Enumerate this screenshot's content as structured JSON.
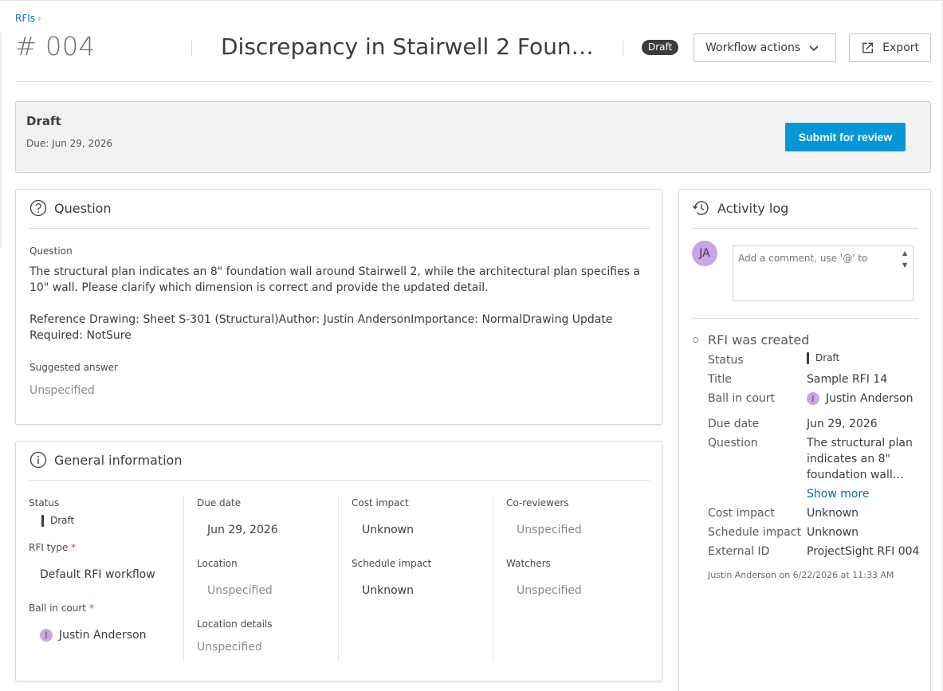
{
  "breadcrumb": {
    "label": "RFIs",
    "separator": "›"
  },
  "header": {
    "number": "# 004",
    "title": "Discrepancy in Stairwell 2 Foun…",
    "status_pill": "Draft",
    "workflow_label": "Workflow actions",
    "export_label": "Export"
  },
  "banner": {
    "title": "Draft",
    "due": "Due: Jun 29, 2026",
    "submit_label": "Submit for review"
  },
  "question_card": {
    "heading": "Question",
    "question_label": "Question",
    "question_line1": "The structural plan indicates an 8\" foundation wall around Stairwell 2, while the architectural plan specifies a",
    "question_line2": "10\" wall. Please clarify which dimension is correct and provide the updated detail.",
    "ref_line1": "Reference Drawing: Sheet S-301 (Structural)Author: Justin AndersonImportance: NormalDrawing Update",
    "ref_line2": "Required: NotSure",
    "suggested_label": "Suggested answer",
    "suggested_value": "Unspecified"
  },
  "general_card": {
    "heading": "General information",
    "status_label": "Status",
    "status_value": "Draft",
    "rfi_type_label": "RFI type",
    "rfi_type_value": "Default RFI workflow",
    "ball_label": "Ball in court",
    "ball_initial": "J",
    "ball_value": "Justin Anderson",
    "due_label": "Due date",
    "due_value": "Jun 29, 2026",
    "location_label": "Location",
    "location_value": "Unspecified",
    "location_details_label": "Location details",
    "location_details_value": "Unspecified",
    "cost_label": "Cost impact",
    "cost_value": "Unknown",
    "schedule_label": "Schedule impact",
    "schedule_value": "Unknown",
    "coreviewers_label": "Co-reviewers",
    "coreviewers_value": "Unspecified",
    "watchers_label": "Watchers",
    "watchers_value": "Unspecified",
    "required_mark": "*"
  },
  "activity": {
    "heading": "Activity log",
    "avatar": "JA",
    "comment_placeholder": "Add a comment, use '@' to",
    "event_title": "RFI was created",
    "status_key": "Status",
    "status_val": "Draft",
    "title_key": "Title",
    "title_val": "Sample RFI 14",
    "ball_key": "Ball in court",
    "ball_initial": "J",
    "ball_val": "Justin Anderson",
    "due_key": "Due date",
    "due_val": "Jun 29, 2026",
    "question_key": "Question",
    "question_l1": "The structural plan",
    "question_l2": "indicates an 8\"",
    "question_l3": "foundation wall…",
    "show_more": "Show more",
    "cost_key": "Cost impact",
    "cost_val": "Unknown",
    "schedule_key": "Schedule impact",
    "schedule_val": "Unknown",
    "external_key": "External ID",
    "external_val": "ProjectSight RFI 004",
    "footer": "Justin Anderson on 6/22/2026 at 11:33 AM"
  },
  "colors": {
    "primary": "#0696d7",
    "link": "#0b6ba8",
    "avatar": "#c9a5ea",
    "pill": "#3c3c3c"
  }
}
